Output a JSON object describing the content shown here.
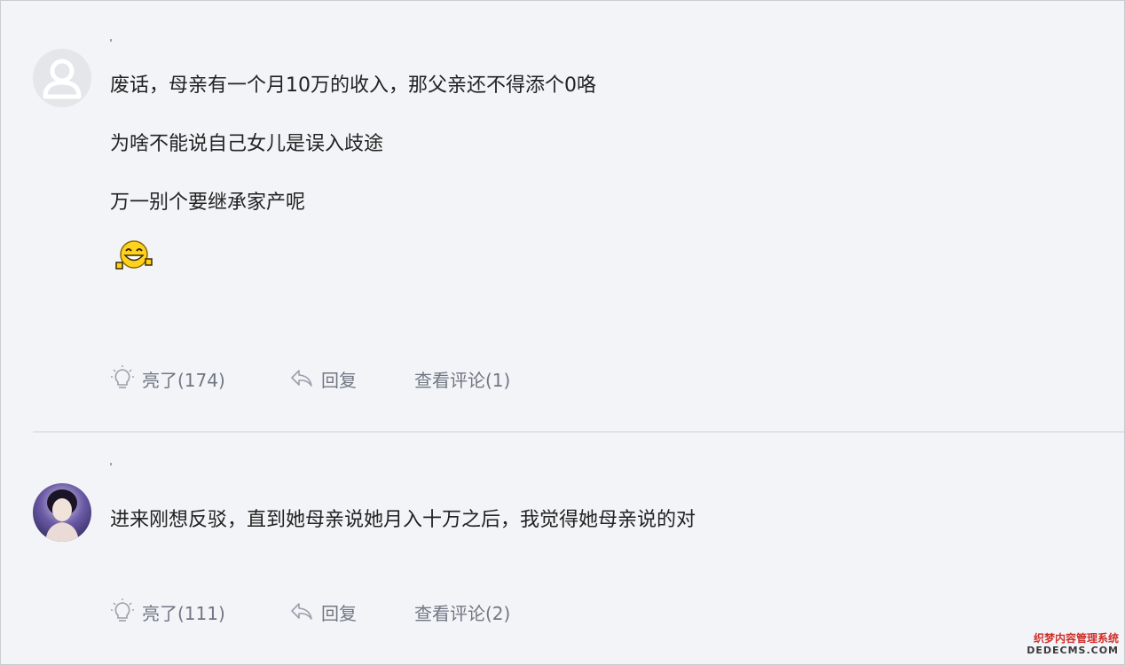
{
  "comments": [
    {
      "lines": [
        "废话，母亲有一个月10万的收入，那父亲还不得添个0咯",
        "为啥不能说自己女儿是误入歧途",
        "万一别个要继承家产呢"
      ],
      "emoji": "laughing-emoji",
      "like_label": "亮了(174)",
      "reply_label": "回复",
      "view_comments_label": "查看评论(1)"
    },
    {
      "lines": [
        "进来刚想反驳，直到她母亲说她月入十万之后，我觉得她母亲说的对"
      ],
      "like_label": "亮了(111)",
      "reply_label": "回复",
      "view_comments_label": "查看评论(2)"
    }
  ],
  "watermark": {
    "line1": "织梦内容管理系统",
    "line2": "DEDECMS.COM"
  },
  "icons": {
    "like": "lightbulb-icon",
    "reply": "reply-arrow-icon",
    "default_avatar": "user-silhouette-icon"
  },
  "colors": {
    "background": "#f3f4f7",
    "text": "#222222",
    "action_text": "#707784",
    "divider": "#e0e2e7"
  }
}
